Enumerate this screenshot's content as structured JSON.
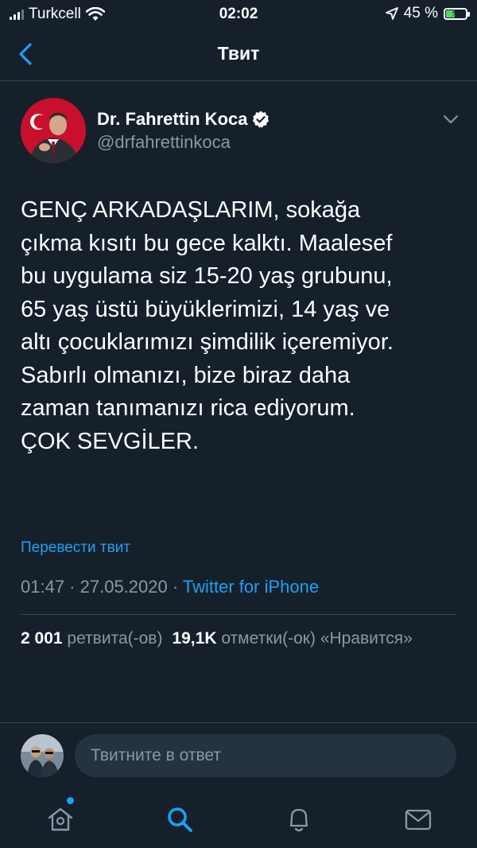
{
  "status_bar": {
    "carrier": "Turkcell",
    "time": "02:02",
    "battery_percent": "45 %",
    "battery_level": 0.45
  },
  "header": {
    "title": "Твит"
  },
  "tweet": {
    "author_name": "Dr. Fahrettin Koca",
    "author_handle": "@drfahrettinkoca",
    "text": "GENÇ ARKADAŞLARIM, sokağa\nçıkma kısıtı bu gece kalktı. Maalesef\nbu uygulama siz 15-20 yaş grubunu,\n65 yaş üstü büyüklerimizi, 14 yaş ve\naltı çocuklarımızı şimdilik içeremiyor.\nSabırlı olmanızı, bize biraz daha\nzaman tanımanızı rica ediyorum.\nÇOK SEVGİLER.",
    "translate_label": "Перевести твит",
    "time": "01:47",
    "date": "27.05.2020",
    "separator": " · ",
    "source": "Twitter for iPhone",
    "stats": {
      "retweets_count": "2 001",
      "retweets_label": "ретвита(-ов)",
      "likes_count": "19,1K",
      "likes_label": "отметки(-ок) «Нравится»"
    }
  },
  "reply": {
    "placeholder": "Твитните в ответ"
  },
  "tabs": [
    "home-icon",
    "search-icon",
    "notifications-icon",
    "messages-icon"
  ],
  "colors": {
    "background": "#15202b",
    "accent": "#1da1f2",
    "secondary_text": "#8899a6",
    "divider": "#38444d",
    "battery": "#4cd964"
  }
}
